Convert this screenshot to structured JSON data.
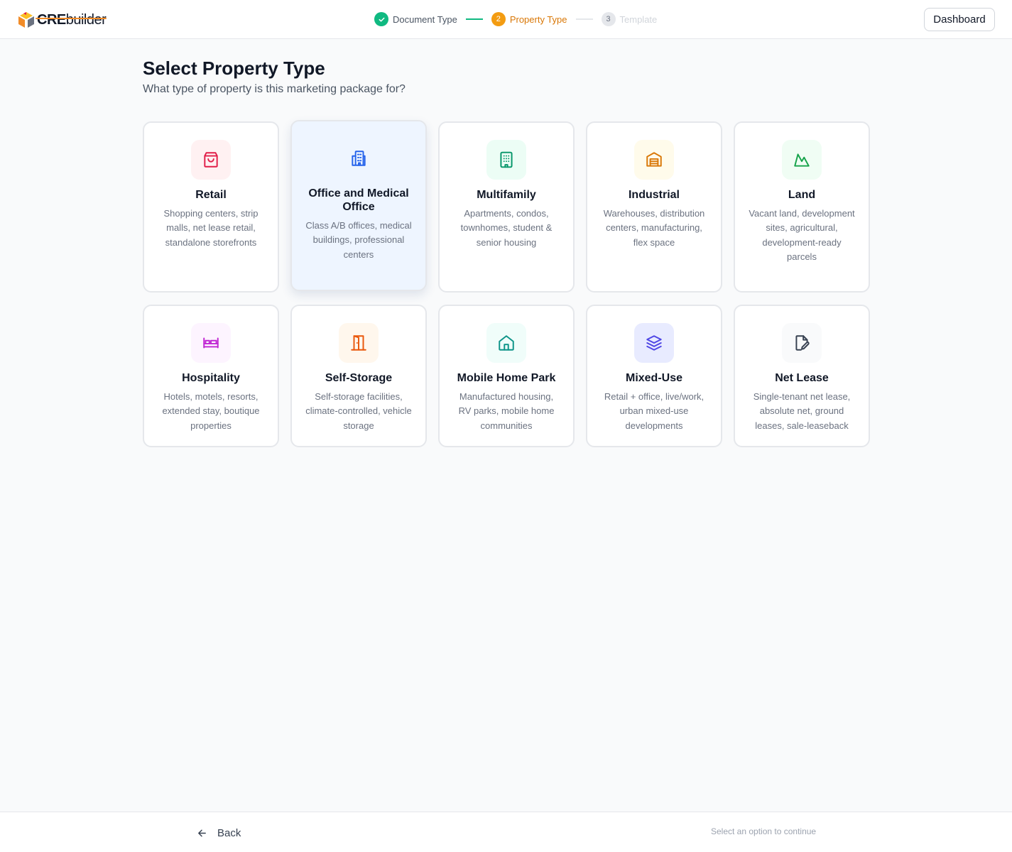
{
  "brand": {
    "name_bold": "CRE",
    "name_light": "builder"
  },
  "stepper": {
    "steps": [
      {
        "number": "✓",
        "label": "Document Type",
        "state": "done"
      },
      {
        "number": "2",
        "label": "Property Type",
        "state": "active"
      },
      {
        "number": "3",
        "label": "Template",
        "state": "todo"
      }
    ]
  },
  "header": {
    "dashboard_label": "Dashboard"
  },
  "page": {
    "title": "Select Property Type",
    "subtitle": "What type of property is this marketing package for?"
  },
  "property_types": [
    {
      "title": "Retail",
      "description": "Shopping centers, strip malls, net lease retail, standalone storefronts",
      "icon": "shopping-bag-icon",
      "color": "#e11d48",
      "bg": "#fff1f2",
      "selected": false
    },
    {
      "title": "Office and Medical Office",
      "description": "Class A/B offices, medical buildings, professional centers",
      "icon": "office-building-icon",
      "color": "#2563eb",
      "bg": "#eef5ff",
      "selected": true
    },
    {
      "title": "Multifamily",
      "description": "Apartments, condos, townhomes, student & senior housing",
      "icon": "apartment-building-icon",
      "color": "#059669",
      "bg": "#ecfdf5",
      "selected": false
    },
    {
      "title": "Industrial",
      "description": "Warehouses, distribution centers, manufacturing, flex space",
      "icon": "warehouse-icon",
      "color": "#d97706",
      "bg": "#fffbeb",
      "selected": false
    },
    {
      "title": "Land",
      "description": "Vacant land, development sites, agricultural, development-ready parcels",
      "icon": "mountain-icon",
      "color": "#16a34a",
      "bg": "#f0fdf4",
      "selected": false
    },
    {
      "title": "Hospitality",
      "description": "Hotels, motels, resorts, extended stay, boutique properties",
      "icon": "bed-icon",
      "color": "#c026d3",
      "bg": "#fdf4ff",
      "selected": false
    },
    {
      "title": "Self-Storage",
      "description": "Self-storage facilities, climate-controlled, vehicle storage",
      "icon": "door-icon",
      "color": "#ea580c",
      "bg": "#fff7ed",
      "selected": false
    },
    {
      "title": "Mobile Home Park",
      "description": "Manufactured housing, RV parks, mobile home communities",
      "icon": "home-icon",
      "color": "#0d9488",
      "bg": "#f0fdfa",
      "selected": false
    },
    {
      "title": "Mixed-Use",
      "description": "Retail + office, live/work, urban mixed-use developments",
      "icon": "layers-icon",
      "color": "#4f46e5",
      "bg": "#eef2ff",
      "selected": false
    },
    {
      "title": "Net Lease",
      "description": "Single-tenant net lease, absolute net, ground leases, sale-leaseback",
      "icon": "document-edit-icon",
      "color": "#374151",
      "bg": "#f9fafb",
      "selected": false
    }
  ],
  "footer": {
    "back_label": "Back",
    "hint": "Select an option to continue"
  }
}
